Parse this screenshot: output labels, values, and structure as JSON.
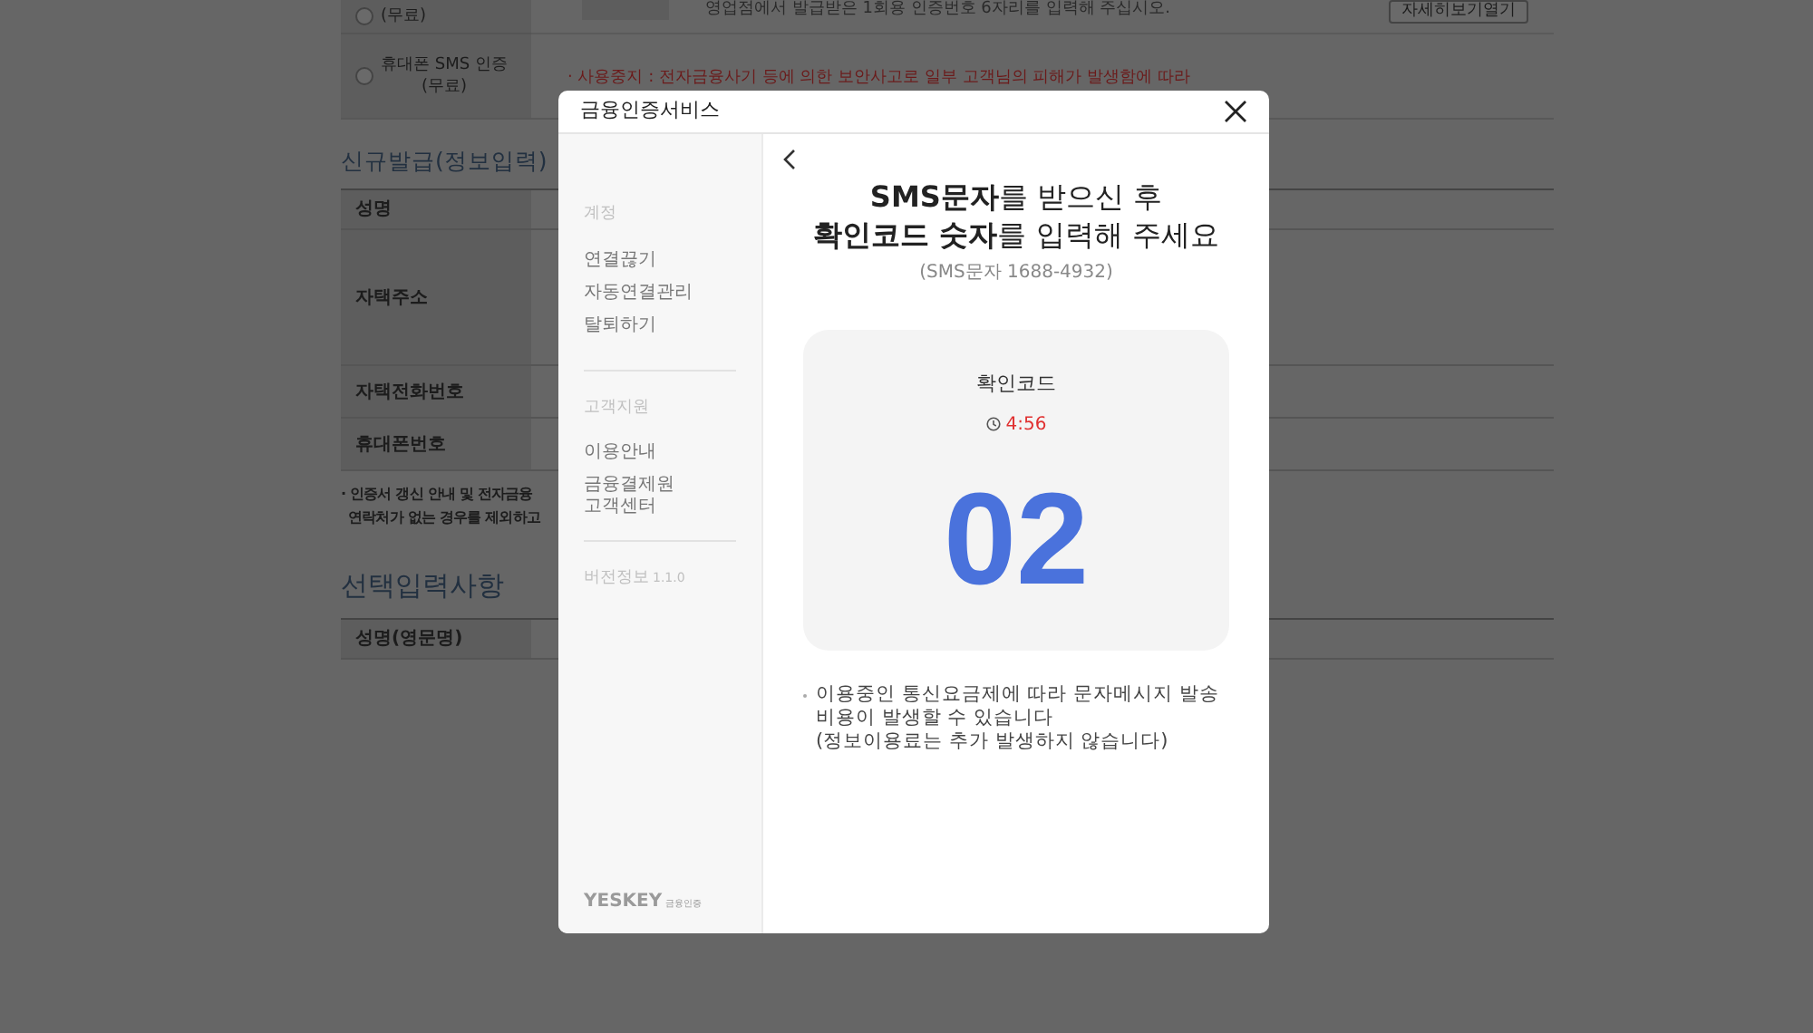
{
  "background_page": {
    "auth_options": [
      {
        "label": "(무료)",
        "selected": false
      },
      {
        "label": "휴대폰 SMS 인증",
        "sublabel": "(무료)",
        "selected": false
      }
    ],
    "otp_instruction": "영업점에서 발급받은 1회용 인증번호 6자리를 입력해 주십시오.",
    "details_button": "자세히보기열기",
    "warning": "· 사용중지 : 전자금융사기 등에 의한 보안사고로 일부 고객님의 피해가 발생함에 따라",
    "section_title": "신규발급(정보입력)",
    "fields": [
      {
        "label": "성명",
        "kind": "name"
      },
      {
        "label": "자택주소",
        "kind": "address"
      },
      {
        "label": "자택전화번호",
        "kind": "phone"
      },
      {
        "label": "휴대폰번호",
        "kind": "phone"
      }
    ],
    "notes": [
      "· 인증서 갱신 안내 및 전자금융",
      "연락처가 없는 경우를 제외하고"
    ],
    "optional_title": "선택입력사항",
    "optional_fields": [
      {
        "label": "성명(영문명)",
        "kind": "name"
      }
    ]
  },
  "dialog": {
    "title": "금융인증서비스",
    "sidebar": {
      "groups": [
        {
          "heading": "계정",
          "items": [
            "연결끊기",
            "자동연결관리",
            "탈퇴하기"
          ]
        },
        {
          "heading": "고객지원",
          "items": [
            "이용안내",
            "금융결제원\n고객센터"
          ]
        }
      ],
      "version_label": "버전정보",
      "version": "1.1.0",
      "logo": "YESKEY",
      "logo_sub": "금융인증"
    },
    "headline_bold": [
      "SMS문자",
      "확인코드 숫자"
    ],
    "headline_rest": [
      "를 받으신 후",
      "를 입력해 주세요"
    ],
    "sender": "(SMS문자 1688-4932)",
    "code_label": "확인코드",
    "timer": "4:56",
    "code": "02",
    "notice": [
      "이용중인 통신요금제에 따라 문자메시지 발송 비용이 발생할 수 있습니다",
      "(정보이용료는 추가 발생하지 않습니다)"
    ]
  }
}
